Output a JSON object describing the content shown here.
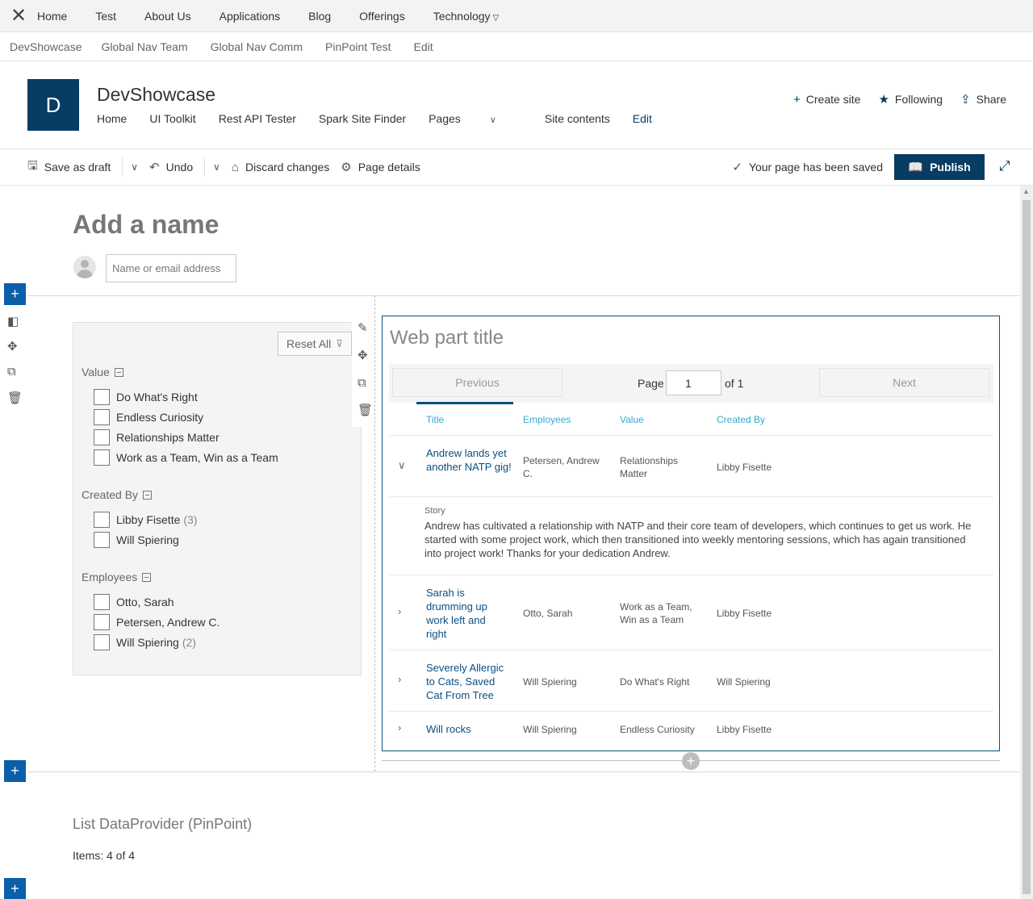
{
  "global_nav": {
    "items": [
      "Home",
      "Test",
      "About Us",
      "Applications",
      "Blog",
      "Offerings",
      "Technology"
    ]
  },
  "hub_nav": {
    "items": [
      "DevShowcase",
      "Global Nav Team",
      "Global Nav Comm",
      "PinPoint Test",
      "Edit"
    ]
  },
  "site": {
    "logo_letter": "D",
    "title": "DevShowcase",
    "nav": [
      "Home",
      "UI Toolkit",
      "Rest API Tester",
      "Spark Site Finder",
      "Pages",
      "Site contents",
      "Edit"
    ],
    "actions": {
      "create": "Create site",
      "following": "Following",
      "share": "Share"
    }
  },
  "commands": {
    "save_draft": "Save as draft",
    "undo": "Undo",
    "discard": "Discard changes",
    "page_details": "Page details",
    "saved_status": "Your page has been saved",
    "publish": "Publish"
  },
  "page": {
    "title_placeholder": "Add a name",
    "author_placeholder": "Name or email address"
  },
  "filters": {
    "reset_label": "Reset All",
    "groups": [
      {
        "label": "Value",
        "items": [
          {
            "label": "Do What's Right",
            "count": ""
          },
          {
            "label": "Endless Curiosity",
            "count": ""
          },
          {
            "label": "Relationships Matter",
            "count": ""
          },
          {
            "label": "Work as a Team, Win as a Team",
            "count": ""
          }
        ]
      },
      {
        "label": "Created By",
        "items": [
          {
            "label": "Libby Fisette",
            "count": "(3)"
          },
          {
            "label": "Will Spiering",
            "count": ""
          }
        ]
      },
      {
        "label": "Employees",
        "items": [
          {
            "label": "Otto, Sarah",
            "count": ""
          },
          {
            "label": "Petersen, Andrew C.",
            "count": ""
          },
          {
            "label": "Will Spiering",
            "count": "(2)"
          }
        ]
      }
    ]
  },
  "webpart": {
    "title": "Web part title",
    "pager": {
      "previous": "Previous",
      "page_label": "Page",
      "page_value": "1",
      "of_label": "of 1",
      "next": "Next"
    },
    "columns": [
      "Title",
      "Employees",
      "Value",
      "Created By"
    ],
    "rows": [
      {
        "title": "Andrew lands yet another NATP gig!",
        "employees": "Petersen, Andrew C.",
        "value": "Relationships Matter",
        "created_by": "Libby Fisette",
        "expanded": true
      },
      {
        "title": "Sarah is drumming up work left and right",
        "employees": "Otto, Sarah",
        "value": "Work as a Team, Win as a Team",
        "created_by": "Libby Fisette",
        "expanded": false
      },
      {
        "title": "Severely Allergic to Cats, Saved Cat From Tree",
        "employees": "Will Spiering",
        "value": "Do What's Right",
        "created_by": "Will Spiering",
        "expanded": false
      },
      {
        "title": "Will rocks",
        "employees": "Will Spiering",
        "value": "Endless Curiosity",
        "created_by": "Libby Fisette",
        "expanded": false
      }
    ],
    "story_label": "Story",
    "story_text": "Andrew has cultivated a relationship with NATP and their core team of developers, which continues to get us work. He started with some project work, which then transitioned into weekly mentoring sessions, which has again transitioned into project work! Thanks for your dedication Andrew."
  },
  "data_provider": {
    "title": "List DataProvider (PinPoint)",
    "items": "Items: 4 of 4"
  },
  "colors": {
    "brand": "#073c63",
    "accent": "#0b5ea8",
    "header_link": "#3aa9c9"
  }
}
